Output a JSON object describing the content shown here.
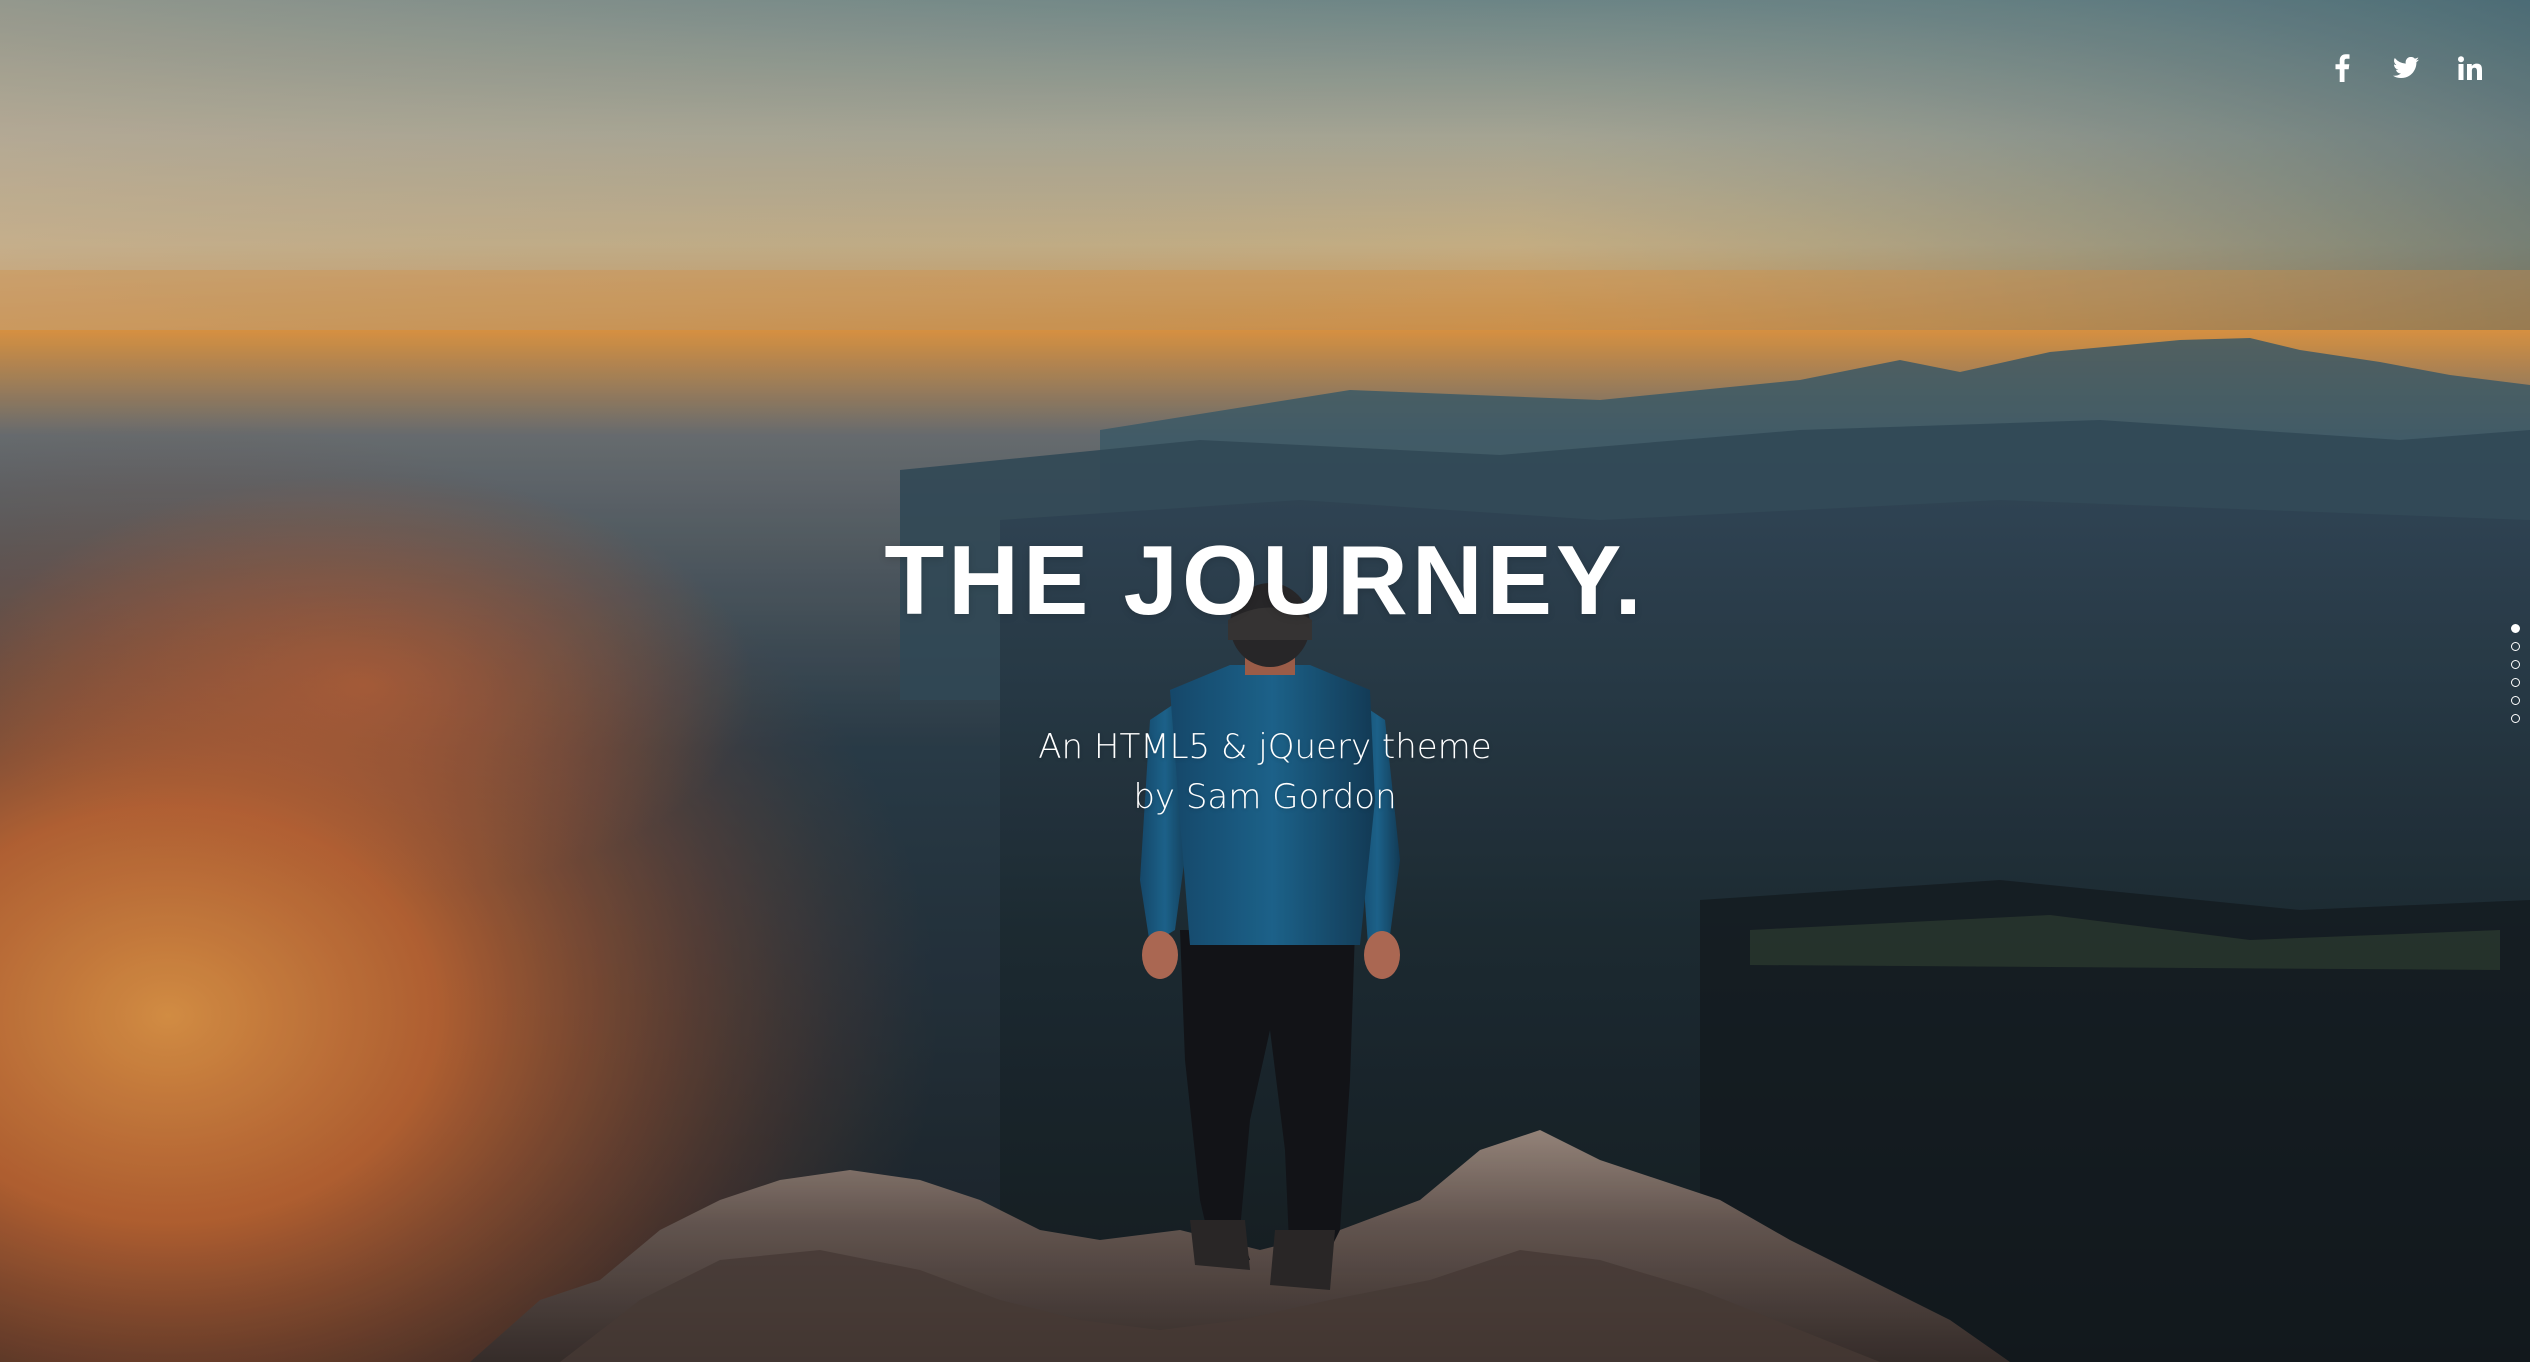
{
  "hero": {
    "title": "THE JOURNEY.",
    "subtitle_line1": "An HTML5 & jQuery theme",
    "subtitle_line2": "by Sam Gordon"
  },
  "social": [
    {
      "icon": "facebook-icon"
    },
    {
      "icon": "twitter-icon"
    },
    {
      "icon": "linkedin-icon"
    }
  ],
  "section_nav": {
    "count": 6,
    "active_index": 0
  },
  "colors": {
    "text": "#ffffff",
    "sky_top": "#4f7480",
    "horizon_glow": "#e8a24a",
    "fog_orange": "#d9723a",
    "valley_dark": "#1c2a33"
  }
}
